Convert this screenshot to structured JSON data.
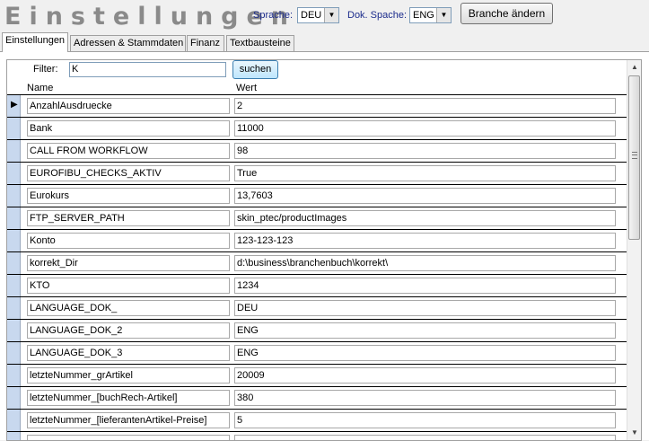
{
  "header": {
    "title": "Einstellungen",
    "sprache_label": "Sprache:",
    "sprache_value": "DEU",
    "dok_sprache_label": "Dok. Spache:",
    "dok_sprache_value": "ENG",
    "branche_button": "Branche ändern"
  },
  "tabs": [
    {
      "label": "Einstellungen",
      "active": true
    },
    {
      "label": "Adressen & Stammdaten",
      "active": false
    },
    {
      "label": "Finanz",
      "active": false
    },
    {
      "label": "Textbausteine",
      "active": false
    }
  ],
  "filter": {
    "label": "Filter:",
    "value": "K",
    "search_button": "suchen"
  },
  "columns": {
    "name": "Name",
    "value": "Wert"
  },
  "rows": [
    {
      "name": "AnzahlAusdruecke",
      "value": "2",
      "current": true
    },
    {
      "name": "Bank",
      "value": "11000"
    },
    {
      "name": "CALL FROM WORKFLOW",
      "value": "98"
    },
    {
      "name": "EUROFIBU_CHECKS_AKTIV",
      "value": "True"
    },
    {
      "name": "Eurokurs",
      "value": "13,7603"
    },
    {
      "name": "FTP_SERVER_PATH",
      "value": "skin_ptec/productImages"
    },
    {
      "name": "Konto",
      "value": "123-123-123"
    },
    {
      "name": "korrekt_Dir",
      "value": "d:\\business\\branchenbuch\\korrekt\\"
    },
    {
      "name": "KTO",
      "value": "1234"
    },
    {
      "name": "LANGUAGE_DOK_",
      "value": "DEU"
    },
    {
      "name": "LANGUAGE_DOK_2",
      "value": "ENG"
    },
    {
      "name": "LANGUAGE_DOK_3",
      "value": "ENG"
    },
    {
      "name": "letzteNummer_grArtikel",
      "value": "20009"
    },
    {
      "name": "letzteNummer_[buchRech-Artikel]",
      "value": "380"
    },
    {
      "name": "letzteNummer_[lieferantenArtikel-Preise]",
      "value": "5"
    }
  ]
}
